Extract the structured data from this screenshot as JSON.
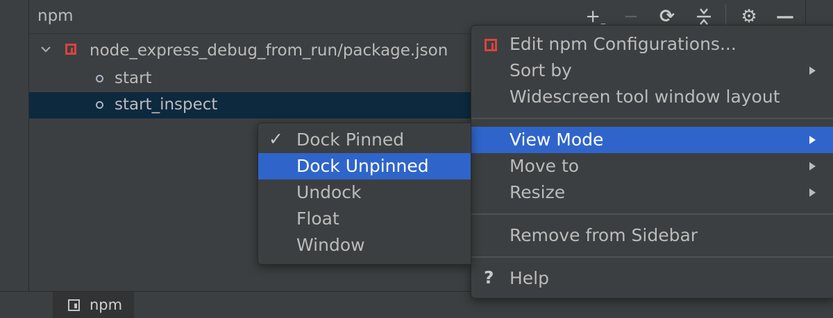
{
  "tool_window": {
    "title": "npm",
    "toolbar": {
      "add_icon": "+",
      "add_sub": "‒",
      "remove_icon": "−",
      "refresh_icon": "⟳",
      "collapse_icon": "↕",
      "settings_icon": "⚙",
      "hide_icon": "—"
    },
    "tree": {
      "package": "node_express_debug_from_run/package.json",
      "scripts": [
        "start",
        "start_inspect"
      ]
    }
  },
  "context_menu": {
    "items": {
      "edit": "Edit npm Configurations...",
      "sort_by": "Sort by",
      "widescreen": "Widescreen tool window layout",
      "view_mode": "View Mode",
      "move_to": "Move to",
      "resize": "Resize",
      "remove": "Remove from Sidebar",
      "help_icon": "?",
      "help": "Help"
    }
  },
  "view_mode_submenu": {
    "check_icon": "✓",
    "items": [
      "Dock Pinned",
      "Dock Unpinned",
      "Undock",
      "Float",
      "Window"
    ]
  },
  "bottom_bar": {
    "tab_label": "npm"
  },
  "colors": {
    "background": "#3c3f41",
    "selection": "#0d293e",
    "menu_highlight": "#2f65ca",
    "npm_red": "#d9443e"
  }
}
